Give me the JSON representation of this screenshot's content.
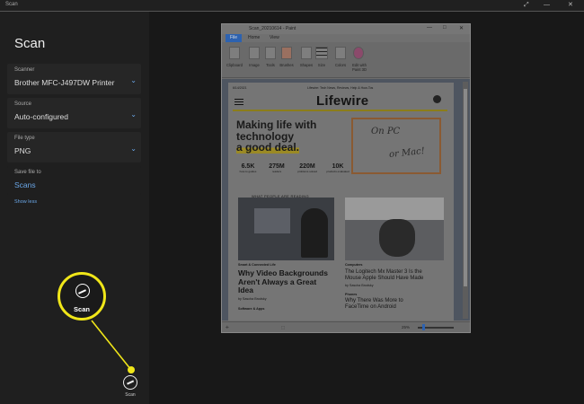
{
  "window": {
    "title": "Scan",
    "controls": [
      "⤢",
      "—",
      "✕"
    ]
  },
  "sidebar": {
    "heading": "Scan",
    "scanner": {
      "label": "Scanner",
      "value": "Brother MFC-J497DW Printer"
    },
    "source": {
      "label": "Source",
      "value": "Auto-configured"
    },
    "file_type": {
      "label": "File type",
      "value": "PNG"
    },
    "save_to": {
      "label": "Save file to",
      "value": "Scans"
    },
    "show_less": "Show less",
    "scan_button_label": "Scan",
    "scan_callout_label": "Scan"
  },
  "callout": {
    "color": "#f0e619"
  },
  "preview": {
    "window_title": "Scan_20210614 - Paint",
    "window_controls": [
      "—",
      "□",
      "✕"
    ],
    "tabs": [
      "File",
      "Home",
      "View"
    ],
    "ribbon_groups": [
      "Clipboard",
      "Image",
      "Tools",
      "Brushes",
      "Shapes",
      "Size",
      "Colors",
      "Edit with Paint 3D"
    ],
    "status_zoom": "25%",
    "status_dims": "⬚",
    "page": {
      "date": "6/14/2021",
      "tagline": "Lifewire: Tech News, Reviews, Help & How-Tos",
      "logo": "Lifewire",
      "hero_line1": "Making life with",
      "hero_line2": "technology",
      "hero_line3": "a good deal.",
      "stats": [
        {
          "n": "6.5K",
          "d": "how-to guides"
        },
        {
          "n": "275M",
          "d": "readers"
        },
        {
          "n": "220M",
          "d": "problems solved"
        },
        {
          "n": "10K",
          "d": "products evaluated"
        }
      ],
      "note_line1": "On PC",
      "note_line2": "or Mac!",
      "what_people": "WHAT PEOPLE ARE READING",
      "article1": {
        "category": "Smart & Connected Life",
        "title_l1": "Why Video Backgrounds",
        "title_l2": "Aren't Always a Great",
        "title_l3": "Idea",
        "byline": "by Sascha Brodsky",
        "category2": "Software & Apps"
      },
      "article2": {
        "category": "Computers",
        "title_l1": "The Logitech Mx Master 3 Is the",
        "title_l2": "Mouse Apple Should Have Made",
        "byline": "by Sascha Brodsky",
        "category2": "Phones",
        "title2_l1": "Why There Was More to",
        "title2_l2": "FaceTime on Android"
      }
    }
  }
}
